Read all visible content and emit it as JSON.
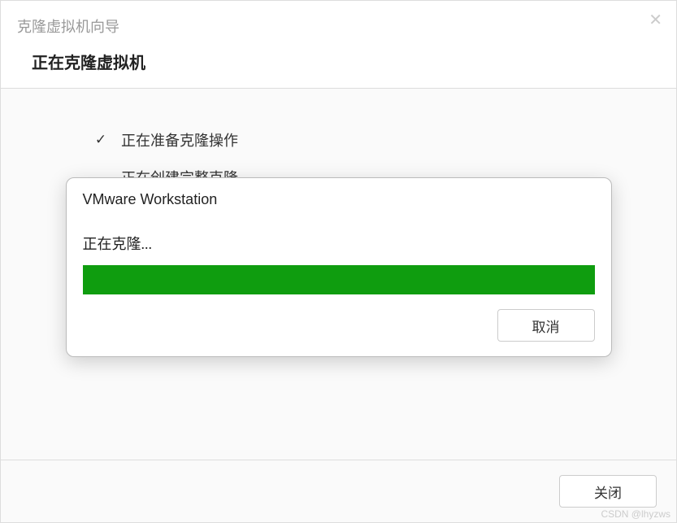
{
  "wizard": {
    "window_title": "克隆虚拟机向导",
    "subtitle": "正在克隆虚拟机",
    "steps": [
      {
        "done": true,
        "label": "正在准备克隆操作"
      },
      {
        "done": false,
        "label": "正在创建完整克隆"
      }
    ],
    "close_label": "关闭"
  },
  "dialog": {
    "title": "VMware Workstation",
    "status": "正在克隆...",
    "progress_percent": 100,
    "cancel_label": "取消"
  },
  "icons": {
    "check": "✓",
    "close_x": "✕"
  },
  "watermark": "CSDN @lhyzws"
}
